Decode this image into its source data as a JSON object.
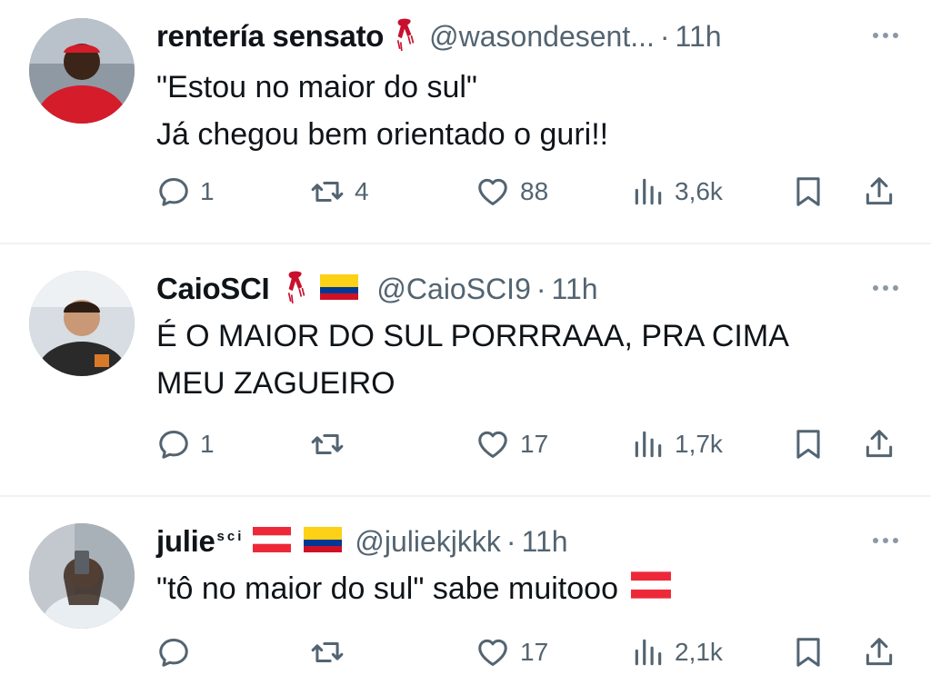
{
  "tweets": [
    {
      "name": "rentería sensato",
      "handle": "@wasondesent...",
      "separator": "·",
      "time": "11h",
      "lines": [
        "\"Estou no maior do sul\"",
        "Já chegou bem orientado o guri!!"
      ],
      "replies": "1",
      "reposts": "4",
      "likes": "88",
      "views": "3,6k"
    },
    {
      "name": "CaioSCI",
      "handle": "@CaioSCI9",
      "separator": "·",
      "time": "11h",
      "lines": [
        "É O MAIOR DO SUL PORRRAAA, PRA CIMA",
        "MEU ZAGUEIRO"
      ],
      "replies": "1",
      "reposts": "",
      "likes": "17",
      "views": "1,7k"
    },
    {
      "name": "julie",
      "name_sup": "sci",
      "handle": "@juliekjkkk",
      "separator": "·",
      "time": "11h",
      "lines": [
        "\"tô no maior do sul\" sabe muitooo"
      ],
      "replies": "",
      "reposts": "",
      "likes": "17",
      "views": "2,1k"
    }
  ],
  "icons": {
    "reply": "speech-bubble-icon",
    "repost": "repost-arrows-icon",
    "like": "heart-icon",
    "views": "bar-chart-icon",
    "bookmark": "bookmark-icon",
    "share": "share-upload-icon",
    "more": "three-dots-icon",
    "scarf": "red-scarf-emoji",
    "flag_colombia": "colombia-flag-emoji",
    "flag_austria": "austria-flag-emoji"
  },
  "colors": {
    "text": "#0f1419",
    "secondary": "#536471",
    "divider": "#eff3f4",
    "scarf": "#c8102e"
  }
}
